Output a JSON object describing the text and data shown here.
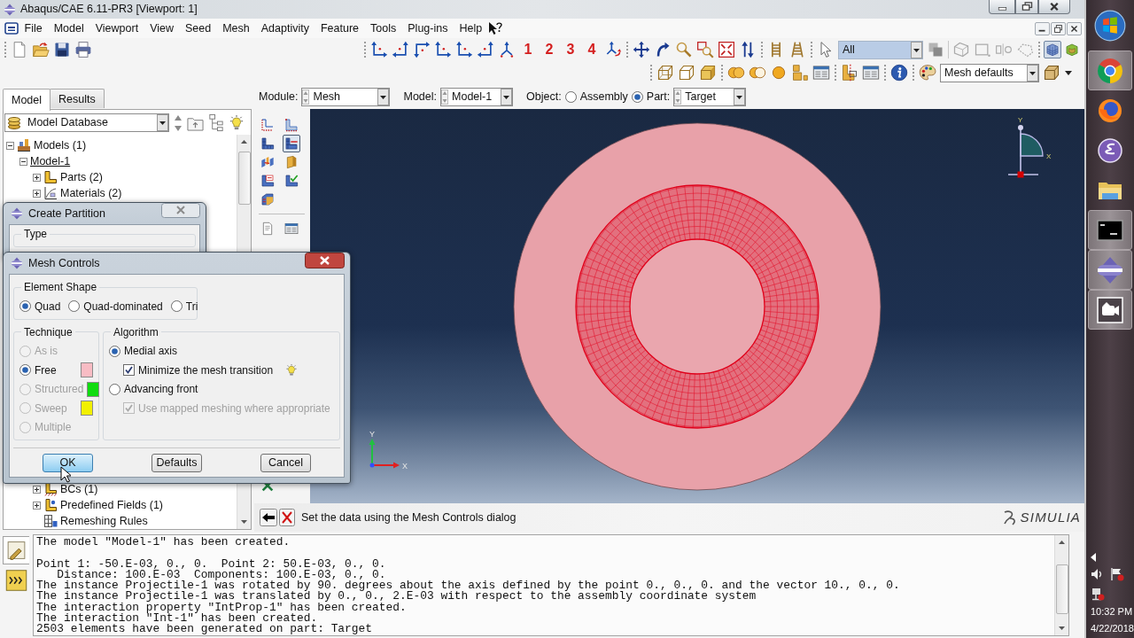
{
  "window": {
    "title": "Abaqus/CAE 6.11-PR3 [Viewport: 1]"
  },
  "menu": [
    "File",
    "Model",
    "Viewport",
    "View",
    "Seed",
    "Mesh",
    "Adaptivity",
    "Feature",
    "Tools",
    "Plug-ins",
    "Help"
  ],
  "toolbar": {
    "view_numbers": [
      "1",
      "2",
      "3",
      "4"
    ],
    "selection_filter": "All",
    "render_toggles": [
      {
        "on": true
      },
      {
        "on": false
      }
    ],
    "render_style": "Mesh defaults"
  },
  "tabs": [
    {
      "label": "Model",
      "selected": true
    },
    {
      "label": "Results",
      "selected": false
    }
  ],
  "context_bar": {
    "module_label": "Module:",
    "module": "Mesh",
    "model_label": "Model:",
    "model": "Model-1",
    "object_label": "Object:",
    "objects": [
      {
        "label": "Assembly",
        "selected": false
      },
      {
        "label": "Part:",
        "selected": true
      }
    ],
    "part": "Target"
  },
  "model_tree": {
    "source": "Model Database",
    "items": [
      {
        "label": "Models (1)",
        "expanded": true,
        "children": [
          {
            "label": "Model-1",
            "expanded": true,
            "current": true,
            "children": [
              {
                "label": "Parts (2)",
                "expanded": false
              },
              {
                "label": "Materials (2)",
                "expanded": false
              }
            ],
            "children_below_dialog": [
              {
                "label": "BCs (1)",
                "expanded": false
              },
              {
                "label": "Predefined Fields (1)",
                "expanded": false
              },
              {
                "label": "Remeshing Rules"
              }
            ]
          }
        ]
      }
    ]
  },
  "toolbox": [
    {
      "active": false
    },
    {
      "active": false
    },
    {
      "active": false
    },
    {
      "active": true
    },
    {
      "active": false
    },
    {
      "active": false
    },
    {
      "active": false
    },
    {
      "active": false
    },
    {
      "active": false
    },
    {
      "active": false
    },
    {
      "active": false
    },
    {
      "active": false
    }
  ],
  "create_partition": {
    "title": "Create Partition",
    "group": "Type"
  },
  "mesh_controls": {
    "title": "Mesh Controls",
    "element_shape": {
      "label": "Element Shape",
      "options": [
        {
          "label": "Quad",
          "selected": true
        },
        {
          "label": "Quad-dominated",
          "selected": false
        },
        {
          "label": "Tri",
          "selected": false
        }
      ]
    },
    "technique": {
      "label": "Technique",
      "options": [
        {
          "label": "As is",
          "selected": false,
          "disabled": true
        },
        {
          "label": "Free",
          "selected": true,
          "disabled": false,
          "color": "#f8bcc4"
        },
        {
          "label": "Structured",
          "selected": false,
          "disabled": true,
          "color": "#10dc10"
        },
        {
          "label": "Sweep",
          "selected": false,
          "disabled": true,
          "color": "#f2f000"
        },
        {
          "label": "Multiple",
          "selected": false,
          "disabled": true
        }
      ]
    },
    "algorithm": {
      "label": "Algorithm",
      "options": [
        {
          "kind": "radio",
          "label": "Medial axis",
          "selected": true,
          "disabled": false
        },
        {
          "kind": "checkbox",
          "label": "Minimize the mesh transition",
          "checked": true,
          "disabled": false,
          "tip": true
        },
        {
          "kind": "radio",
          "label": "Advancing front",
          "selected": false,
          "disabled": false
        },
        {
          "kind": "checkbox",
          "label": "Use mapped meshing where appropriate",
          "checked": true,
          "disabled": true
        }
      ]
    },
    "buttons": [
      {
        "label": "OK",
        "highlighted": true
      },
      {
        "label": "Defaults",
        "highlighted": false
      },
      {
        "label": "Cancel",
        "highlighted": false
      }
    ]
  },
  "viewport": {
    "view_triad_labels": [
      "Y",
      "X"
    ],
    "origin_triad_labels": [
      "Y",
      "X"
    ]
  },
  "prompt": "Set the data using the Mesh Controls dialog",
  "logo": "SIMULIA",
  "console_tabs": [
    {
      "selected": true
    },
    {
      "selected": false
    }
  ],
  "messages": [
    [
      "The model \"Model-1\" has been created."
    ],
    [
      "Point 1: -50.E-03, 0., 0.  Point 2: 50.E-03, 0., 0.",
      "   Distance: 100.E-03  Components: 100.E-03, 0., 0.",
      "The instance Projectile-1 was rotated by 90. degrees about the axis defined by the point 0., 0., 0. and the vector 10., 0., 0.",
      "The instance Projectile-1 was translated by 0., 0., 2.E-03 with respect to the assembly coordinate system",
      "The interaction property \"IntProp-1\" has been created.",
      "The interaction \"Int-1\" has been created.",
      "2503 elements have been generated on part: Target"
    ]
  ],
  "taskbar": {
    "buttons": [
      {
        "open": true
      },
      {
        "open": false
      },
      {
        "open": false
      },
      {
        "open": false
      },
      {
        "open": true
      },
      {
        "open": true
      },
      {
        "open": true
      }
    ],
    "time": "10:32 PM",
    "date": "4/22/2018"
  }
}
